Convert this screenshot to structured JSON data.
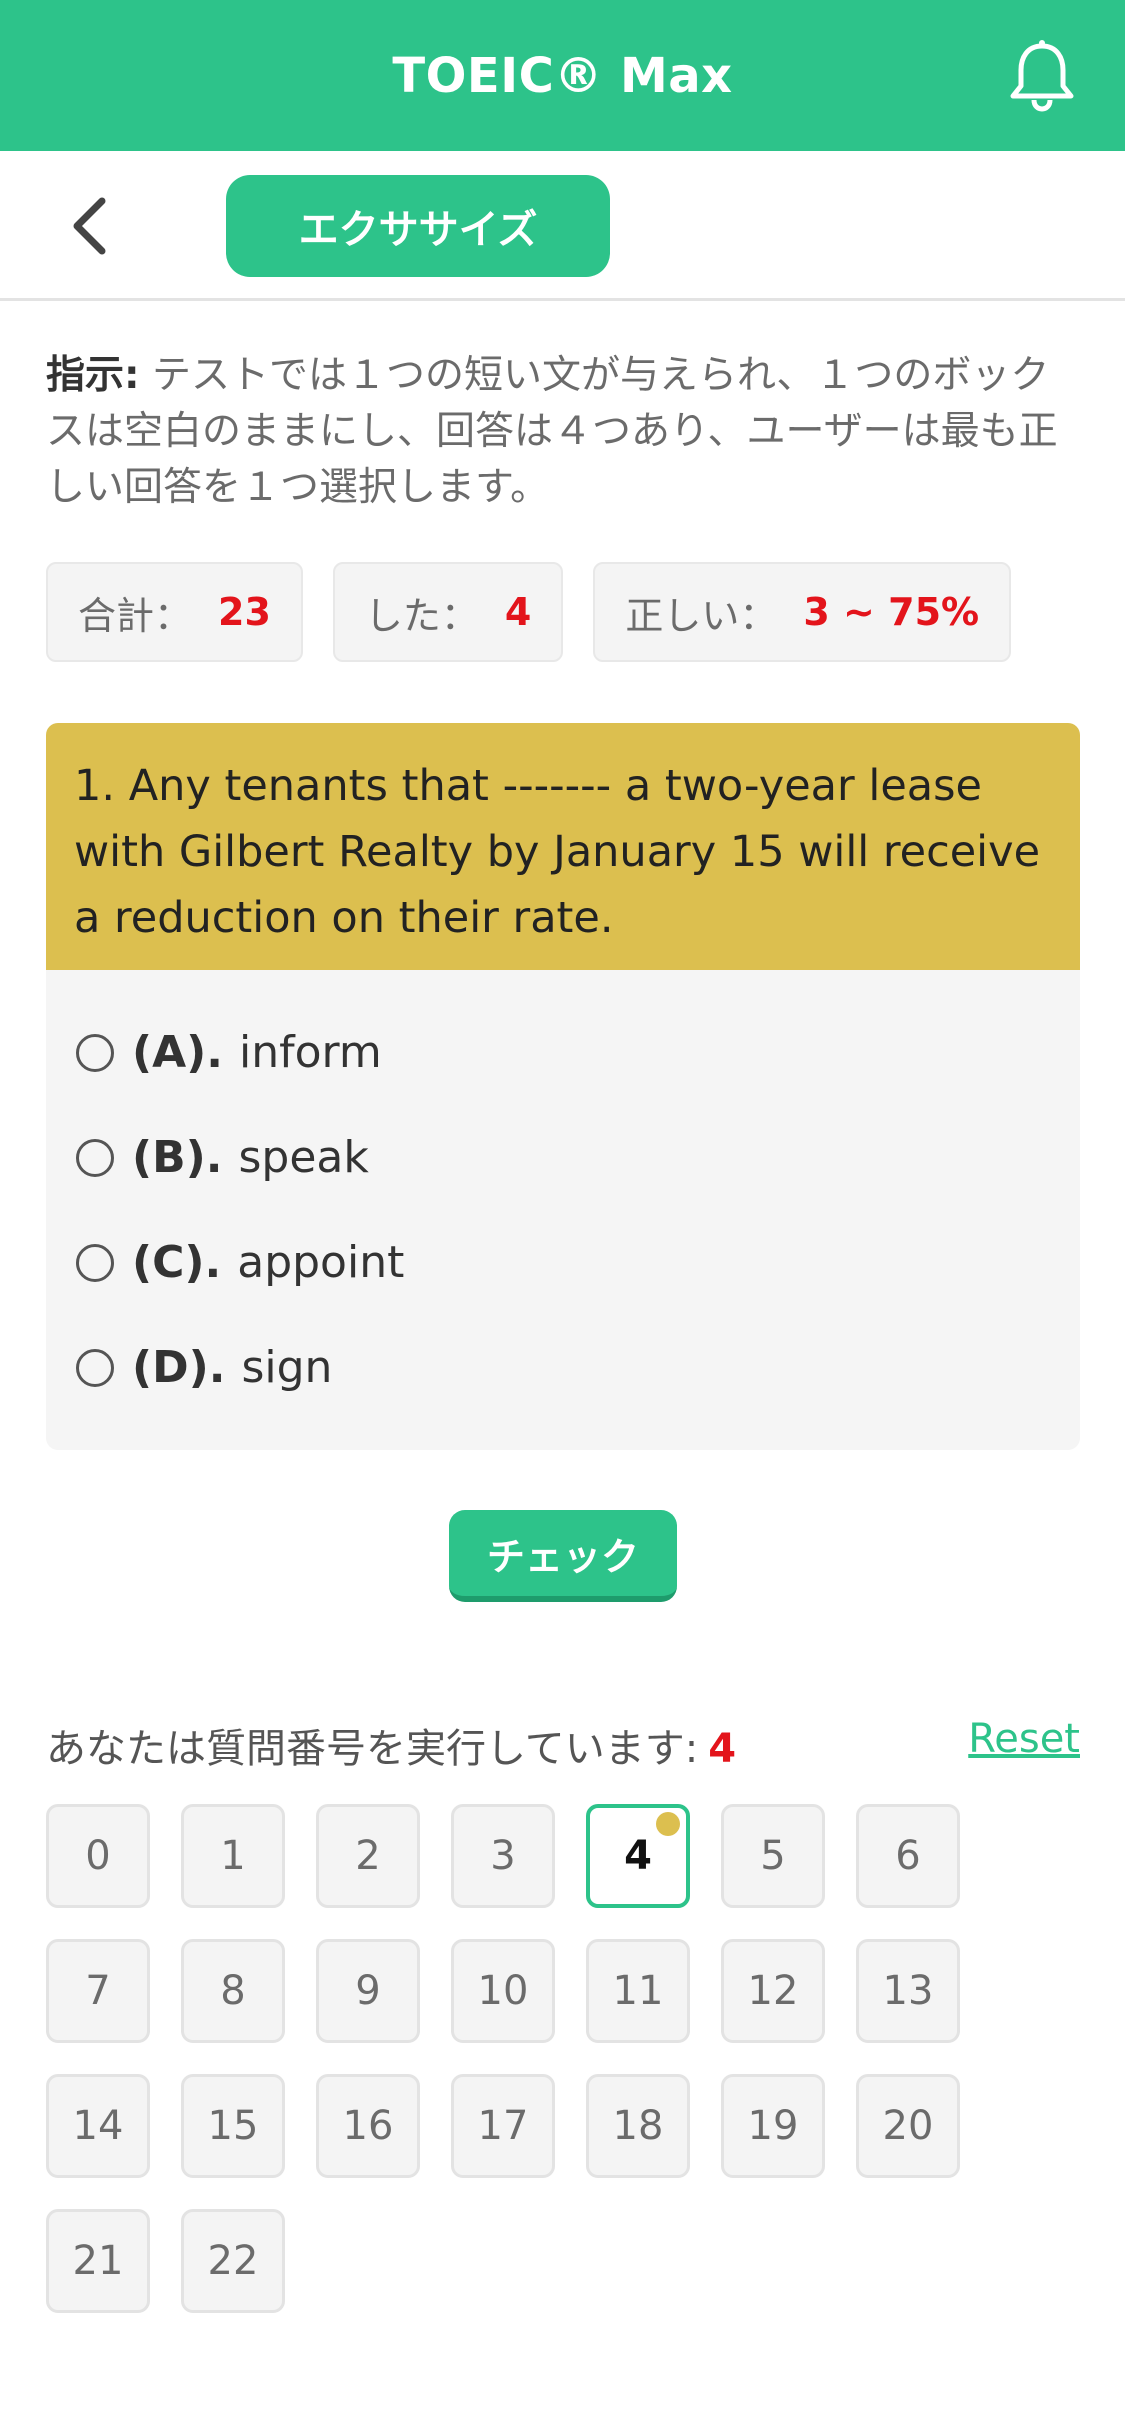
{
  "header": {
    "title": "TOEIC® Max",
    "colors": {
      "primary": "#2dc38a",
      "question_bg": "#dcbf4f",
      "highlight": "#e3141b"
    },
    "bell_icon": "bell-icon"
  },
  "subnav": {
    "back_icon": "chevron-left-icon",
    "tab_label": "エクササイズ"
  },
  "instruction": {
    "label": "指示:",
    "text": " テストでは１つの短い文が与えられ、１つのボックスは空白のままにし、回答は４つあり、ユーザーは最も正しい回答を１つ選択します。"
  },
  "stats": {
    "total_label": "合計：",
    "total_value": "23",
    "done_label": "した：",
    "done_value": "4",
    "correct_label": "正しい：",
    "correct_value": "3 ~ 75%"
  },
  "question": {
    "text": "1. Any tenants that ------- a two-year lease with Gilbert Realty by January 15 will receive a reduction on their rate.",
    "options": [
      {
        "letter": "(A).",
        "text": "inform"
      },
      {
        "letter": "(B).",
        "text": "speak"
      },
      {
        "letter": "(C).",
        "text": "appoint"
      },
      {
        "letter": "(D).",
        "text": "sign"
      }
    ]
  },
  "check_button": "チェック",
  "progress": {
    "label": "あなたは質問番号を実行しています:",
    "current": "4",
    "reset": "Reset"
  },
  "question_numbers": [
    "0",
    "1",
    "2",
    "3",
    "4",
    "5",
    "6",
    "7",
    "8",
    "9",
    "10",
    "11",
    "12",
    "13",
    "14",
    "15",
    "16",
    "17",
    "18",
    "19",
    "20",
    "21",
    "22"
  ],
  "active_question": "4"
}
